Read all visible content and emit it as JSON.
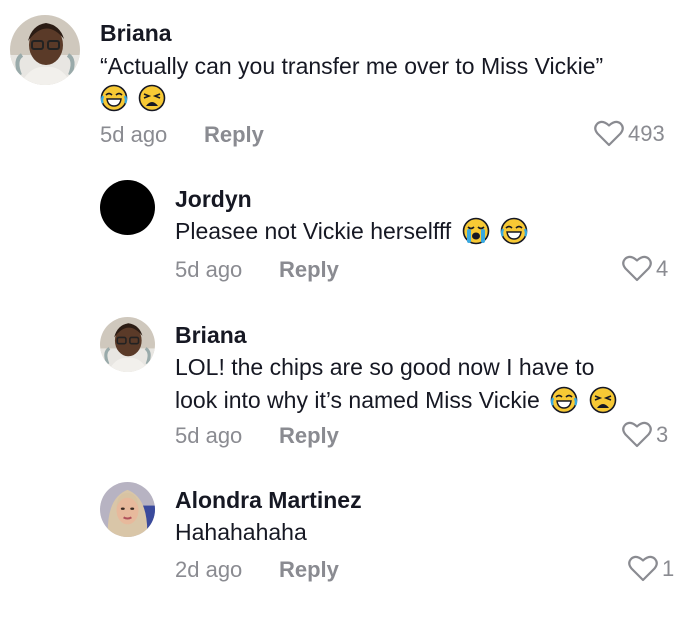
{
  "comments": [
    {
      "author": "Briana",
      "text": "“Actually can you transfer me over to Miss Vickie”",
      "emojis": [
        "laughing-tears-emoji",
        "weary-face-emoji"
      ],
      "time": "5d ago",
      "reply_label": "Reply",
      "likes": "493"
    },
    {
      "author": "Jordyn",
      "text": "Pleasee not Vickie herselfff",
      "emojis": [
        "loudly-crying-emoji",
        "laughing-tears-emoji"
      ],
      "time": "5d ago",
      "reply_label": "Reply",
      "likes": "4"
    },
    {
      "author": "Briana",
      "text_line1": "LOL! the chips are so good now I have to",
      "text_line2": "look into why it’s named Miss Vickie",
      "emojis": [
        "laughing-tears-emoji",
        "weary-face-emoji"
      ],
      "time": "5d ago",
      "reply_label": "Reply",
      "likes": "3"
    },
    {
      "author": "Alondra Martinez",
      "text": "Hahahahaha",
      "time": "2d ago",
      "reply_label": "Reply",
      "likes": "1"
    }
  ],
  "colors": {
    "text_primary": "#161823",
    "text_secondary": "#8a8b91",
    "emoji_yellow": "#f7c935",
    "emoji_outline": "#161823"
  }
}
